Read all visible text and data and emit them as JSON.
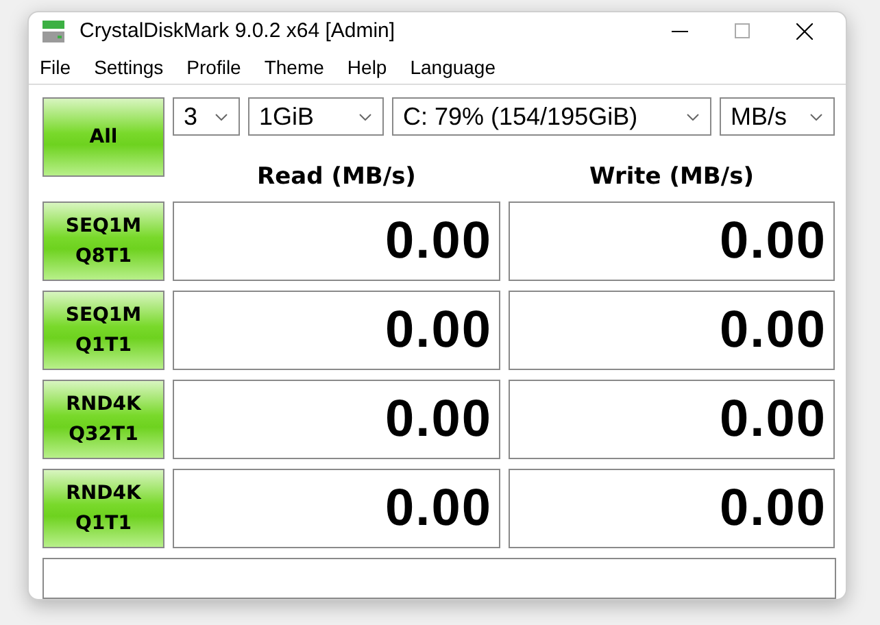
{
  "window": {
    "title": "CrystalDiskMark 9.0.2 x64 [Admin]"
  },
  "menu": [
    "File",
    "Settings",
    "Profile",
    "Theme",
    "Help",
    "Language"
  ],
  "all_button": "All",
  "selectors": [
    {
      "kind": "count",
      "value": "3"
    },
    {
      "kind": "size",
      "value": "1GiB"
    },
    {
      "kind": "drive",
      "value": "C: 79% (154/195GiB)"
    },
    {
      "kind": "unit",
      "value": "MB/s"
    }
  ],
  "columns": [
    "Read (MB/s)",
    "Write (MB/s)"
  ],
  "tests": [
    {
      "line1": "SEQ1M",
      "line2": "Q8T1",
      "read": "0.00",
      "write": "0.00"
    },
    {
      "line1": "SEQ1M",
      "line2": "Q1T1",
      "read": "0.00",
      "write": "0.00"
    },
    {
      "line1": "RND4K",
      "line2": "Q32T1",
      "read": "0.00",
      "write": "0.00"
    },
    {
      "line1": "RND4K",
      "line2": "Q1T1",
      "read": "0.00",
      "write": "0.00"
    }
  ]
}
